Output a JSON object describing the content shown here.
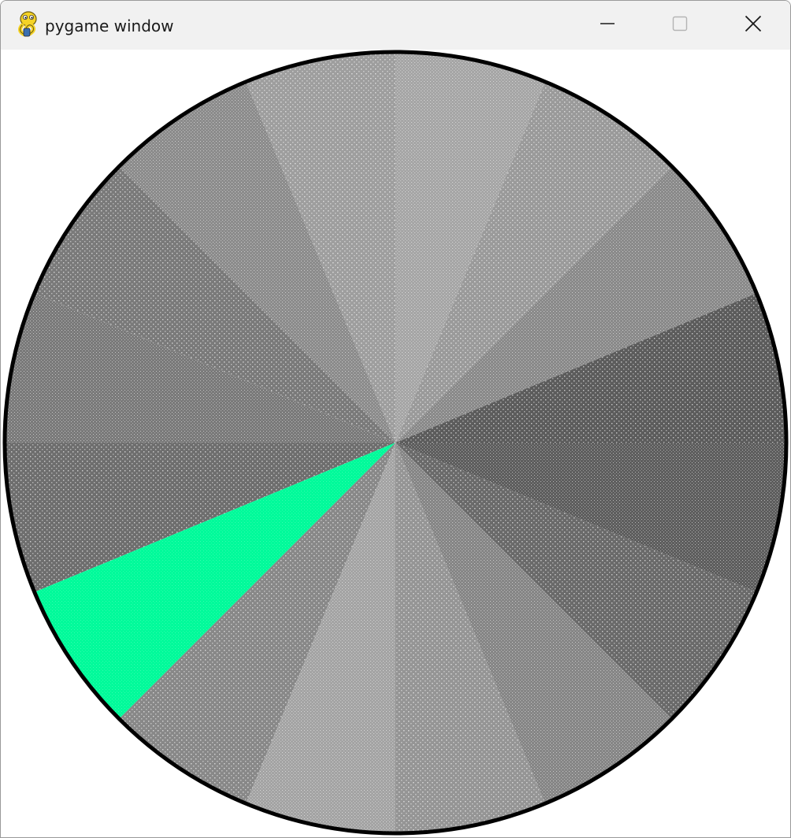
{
  "window": {
    "title": "pygame window",
    "controls": {
      "minimize_icon": "minimize-icon",
      "maximize_icon": "maximize-icon",
      "close_icon": "close-icon"
    },
    "app_icon": "pygame-snake-icon"
  },
  "wheel": {
    "segment_count": 16,
    "highlighted_segment_index": 9,
    "highlight_color": "#00fa9a",
    "outline_color": "#000000",
    "segment_colors": [
      "#5c5c5c",
      "#8a8a8a",
      "#9a9a9a",
      "#a6a6a6",
      "#9e9e9e",
      "#8c8c8c",
      "#7a7a7a",
      "#7a7a7a",
      "#6e6e6e",
      "#00fa9a",
      "#888888",
      "#a4a4a4",
      "#959595",
      "#868686",
      "#6a6a6a",
      "#5e5e5e"
    ]
  }
}
